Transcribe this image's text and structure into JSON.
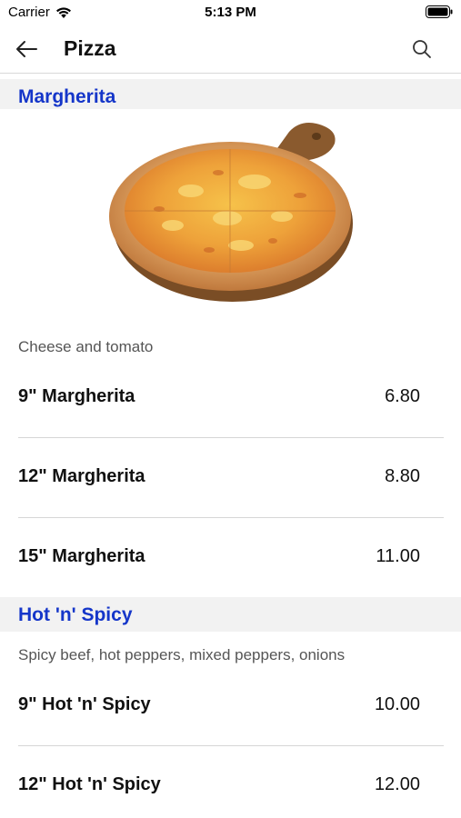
{
  "status": {
    "carrier": "Carrier",
    "time": "5:13 PM"
  },
  "nav": {
    "title": "Pizza"
  },
  "sections": [
    {
      "title": "Margherita",
      "description": "Cheese and tomato",
      "items": [
        {
          "name": "9\" Margherita",
          "price": "6.80"
        },
        {
          "name": "12\" Margherita",
          "price": "8.80"
        },
        {
          "name": "15\" Margherita",
          "price": "11.00"
        }
      ]
    },
    {
      "title": "Hot 'n' Spicy",
      "description": "Spicy beef, hot peppers, mixed peppers, onions",
      "items": [
        {
          "name": "9\" Hot 'n' Spicy",
          "price": "10.00"
        },
        {
          "name": "12\" Hot 'n' Spicy",
          "price": "12.00"
        }
      ]
    }
  ],
  "colors": {
    "accent": "#1536c9",
    "header_bg": "#f2f2f2",
    "divider": "#d6d6d6"
  },
  "icons": {
    "back": "arrow-left-icon",
    "search": "search-icon",
    "wifi": "wifi-icon",
    "battery": "battery-icon"
  }
}
